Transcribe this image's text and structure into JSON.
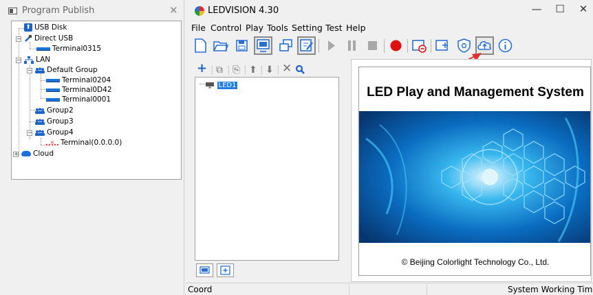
{
  "left_panel": {
    "title": "Program Publish",
    "close_label": "✕",
    "tree": {
      "usb_disk": "USB Disk",
      "direct_usb": "Direct USB",
      "terminal_0315": "Terminal0315",
      "lan": "LAN",
      "default_group": "Default Group",
      "terminal_0204": "Terminal0204",
      "terminal_0d42": "Terminal0D42",
      "terminal_0001": "Terminal0001",
      "group2": "Group2",
      "group3": "Group3",
      "group4": "Group4",
      "terminal_bad": "Terminal(0.0.0.0)",
      "cloud": "Cloud"
    }
  },
  "window": {
    "title": "LEDVISION 4.30",
    "minimize": "—",
    "maximize": "☐",
    "close": "✕"
  },
  "menu": [
    "File",
    "Control",
    "Play",
    "Tools",
    "Setting",
    "Test",
    "Help"
  ],
  "toolbar_icons": [
    "new-file-icon",
    "open-folder-icon",
    "save-icon",
    "display-icon",
    "copy-window-icon",
    "edit-icon",
    "play-icon",
    "pause-icon",
    "stop-icon",
    "record-icon",
    "screen-off-icon",
    "capture-icon",
    "shield-icon",
    "cloud-upload-icon",
    "info-icon"
  ],
  "device_list": {
    "item": "LED1"
  },
  "banner": {
    "title": "LED Play and Management System",
    "copyright": "© Beijing Colorlight Technology Co., Ltd."
  },
  "status": {
    "coord": "Coord",
    "working_time": "System Working Time"
  },
  "colors": {
    "accent_blue": "#1e7dde",
    "annotation_red": "#e03030"
  }
}
